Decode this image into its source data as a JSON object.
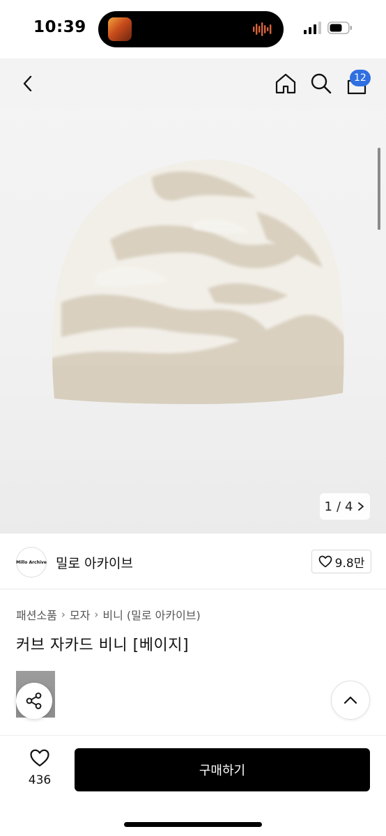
{
  "status": {
    "time": "10:39"
  },
  "header": {
    "cart_count": "12"
  },
  "gallery": {
    "current": "1",
    "separator": "/",
    "total": "4"
  },
  "brand": {
    "logo_text": "Millo Archive",
    "name": "밀로 아카이브",
    "like_count": "9.8만"
  },
  "breadcrumb": [
    "패션소품",
    "모자",
    "비니 (밀로 아카이브)"
  ],
  "product": {
    "title": "커브 자카드 비니 [베이지]"
  },
  "bottom": {
    "wish_count": "436",
    "buy_label": "구매하기"
  },
  "icons": [
    "back-icon",
    "home-icon",
    "search-icon",
    "cart-icon",
    "chevron-right-icon",
    "heart-icon",
    "share-icon",
    "chevron-up-icon"
  ],
  "colors": {
    "badge": "#2f6fe0",
    "buy_button": "#000000",
    "beanie_cream": "#f3f0e8",
    "beanie_beige": "#d8cfbf"
  }
}
